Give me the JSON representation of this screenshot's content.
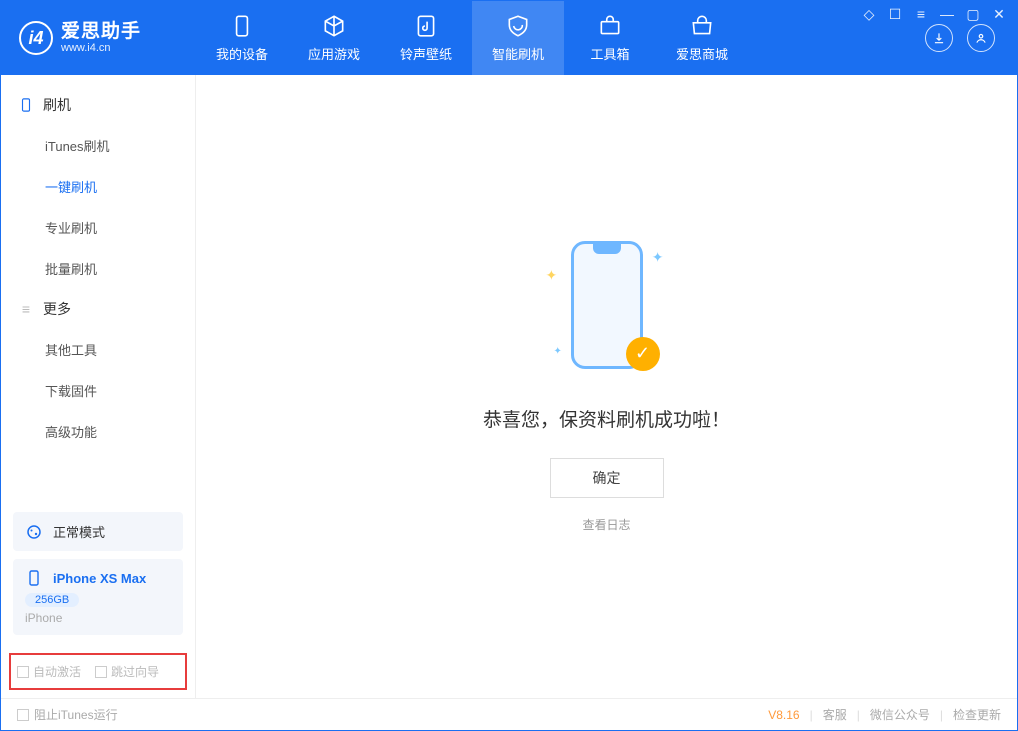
{
  "app": {
    "title": "爱思助手",
    "subtitle": "www.i4.cn"
  },
  "top_tabs": [
    {
      "label": "我的设备"
    },
    {
      "label": "应用游戏"
    },
    {
      "label": "铃声壁纸"
    },
    {
      "label": "智能刷机"
    },
    {
      "label": "工具箱"
    },
    {
      "label": "爱思商城"
    }
  ],
  "sidebar": {
    "group1": {
      "title": "刷机",
      "items": [
        "iTunes刷机",
        "一键刷机",
        "专业刷机",
        "批量刷机"
      ]
    },
    "group2": {
      "title": "更多",
      "items": [
        "其他工具",
        "下载固件",
        "高级功能"
      ]
    }
  },
  "mode_card": {
    "label": "正常模式"
  },
  "device_card": {
    "name": "iPhone XS Max",
    "storage": "256GB",
    "type": "iPhone"
  },
  "options": {
    "auto_activate": "自动激活",
    "skip_guide": "跳过向导"
  },
  "main": {
    "success_text": "恭喜您，保资料刷机成功啦！",
    "ok_button": "确定",
    "view_log": "查看日志"
  },
  "statusbar": {
    "block_itunes": "阻止iTunes运行",
    "version": "V8.16",
    "support": "客服",
    "wechat": "微信公众号",
    "check_update": "检查更新"
  }
}
